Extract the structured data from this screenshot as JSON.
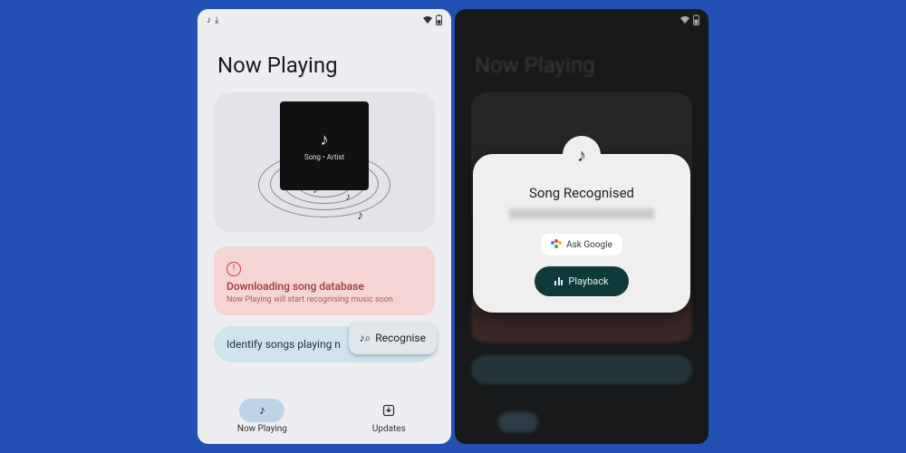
{
  "left": {
    "page_title": "Now Playing",
    "album_caption": "Song • Artist",
    "alert": {
      "icon": "!",
      "title": "Downloading song database",
      "subtitle": "Now Playing will start recognising music soon"
    },
    "identify_label": "Identify songs playing n",
    "recognise_label": "Recognise",
    "nav": {
      "now_playing": "Now Playing",
      "updates": "Updates"
    }
  },
  "right": {
    "page_title": "Now Playing",
    "modal": {
      "title": "Song Recognised",
      "ask_label": "Ask Google",
      "playback_label": "Playback"
    }
  }
}
